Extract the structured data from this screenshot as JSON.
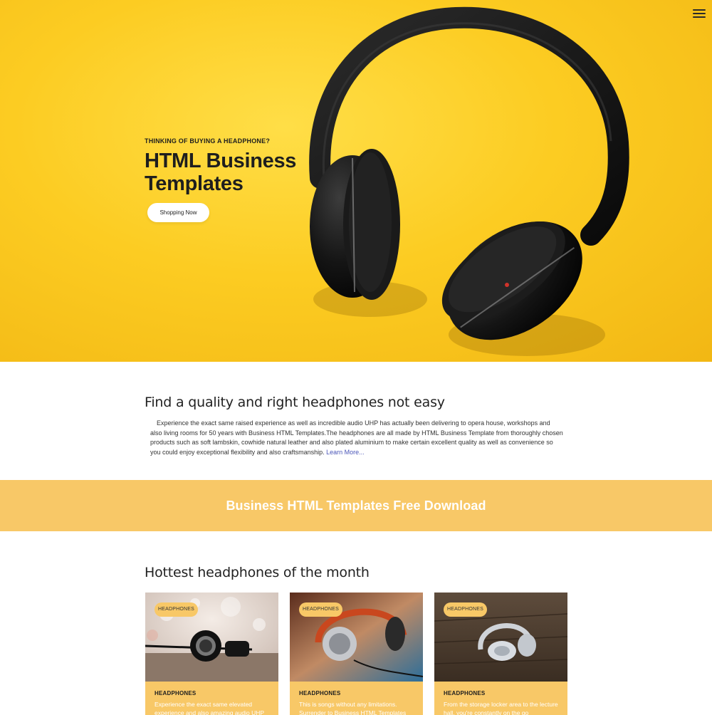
{
  "nav": {
    "menu_icon": "hamburger-menu-icon"
  },
  "hero": {
    "eyebrow": "THINKING OF BUYING A HEADPHONE?",
    "title": "HTML Business Templates",
    "cta_label": "Shopping Now",
    "image": "headphones-on-yellow-background",
    "background_color": "#fccc22"
  },
  "intro": {
    "title": "Find a quality and right headphones not easy",
    "text": "Experience the exact same raised experience as well as incredible audio UHP has actually been delivering to opera house, workshops and also living rooms for 50 years with Business HTML Templates.The headphones are all made by HTML Business Template from thoroughly chosen products such as soft lambskin, cowhide natural leather and also plated aluminium to make certain excellent quality as well as convenience so you could enjoy exceptional flexibility and also craftsmanship. ",
    "link_label": "Learn More..."
  },
  "banner": {
    "text": "Business HTML Templates Free Download",
    "background_color": "#f8c867"
  },
  "products": {
    "title": "Hottest headphones of the month",
    "cards": [
      {
        "badge": "HEADPHONES",
        "title": "HEADPHONES",
        "text": "Experience the exact same elevated experience and also amazing audio UHP",
        "image": "black-headphones-bokeh-photo"
      },
      {
        "badge": "HEADPHONES",
        "title": "HEADPHONES",
        "text": "This is songs without any limitations. Surrender to Business HTML Templates",
        "image": "silver-orange-headphones-photo"
      },
      {
        "badge": "HEADPHONES",
        "title": "HEADPHONES",
        "text": "From the storage locker area to the lecture hall, you're constantly on the go",
        "image": "white-headphones-wood-photo"
      }
    ]
  }
}
